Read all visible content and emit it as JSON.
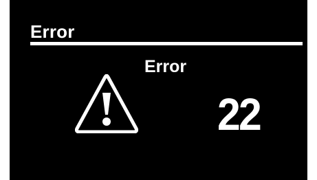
{
  "screen": {
    "background_color": "#000000",
    "foreground_color": "#ffffff"
  },
  "header": {
    "title": "Error"
  },
  "message": {
    "title": "Error",
    "code": "22",
    "icon": "warning-icon"
  }
}
